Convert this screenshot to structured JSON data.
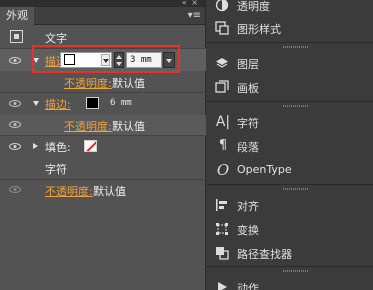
{
  "appearance_panel": {
    "tab_title": "外观",
    "top_controls": "«  ×",
    "object_label": "文字",
    "stroke1": {
      "label": "描边:",
      "weight": "3 mm"
    },
    "opacity1": {
      "label": "不透明度:",
      "value": "默认值"
    },
    "stroke2": {
      "label": "描边:",
      "weight": "6 mm"
    },
    "opacity2": {
      "label": "不透明度:",
      "value": "默认值"
    },
    "fill": {
      "label": "填色:"
    },
    "characters_label": "字符",
    "opacity3": {
      "label": "不透明度:",
      "value": "默认值"
    }
  },
  "right_dock": {
    "items": [
      {
        "label": "透明度",
        "icon": "transparency-icon"
      },
      {
        "label": "图形样式",
        "icon": "graphic-styles-icon"
      },
      {
        "label": "图层",
        "icon": "layers-icon"
      },
      {
        "label": "画板",
        "icon": "artboards-icon"
      },
      {
        "label": "字符",
        "icon": "character-icon"
      },
      {
        "label": "段落",
        "icon": "paragraph-icon"
      },
      {
        "label": "OpenType",
        "icon": "opentype-icon"
      },
      {
        "label": "对齐",
        "icon": "align-icon"
      },
      {
        "label": "变换",
        "icon": "transform-icon"
      },
      {
        "label": "路径查找器",
        "icon": "pathfinder-icon"
      },
      {
        "label": "动作",
        "icon": "actions-icon"
      }
    ]
  },
  "colors": {
    "link_orange": "#f0a33c",
    "highlight_red": "#e8312a"
  }
}
